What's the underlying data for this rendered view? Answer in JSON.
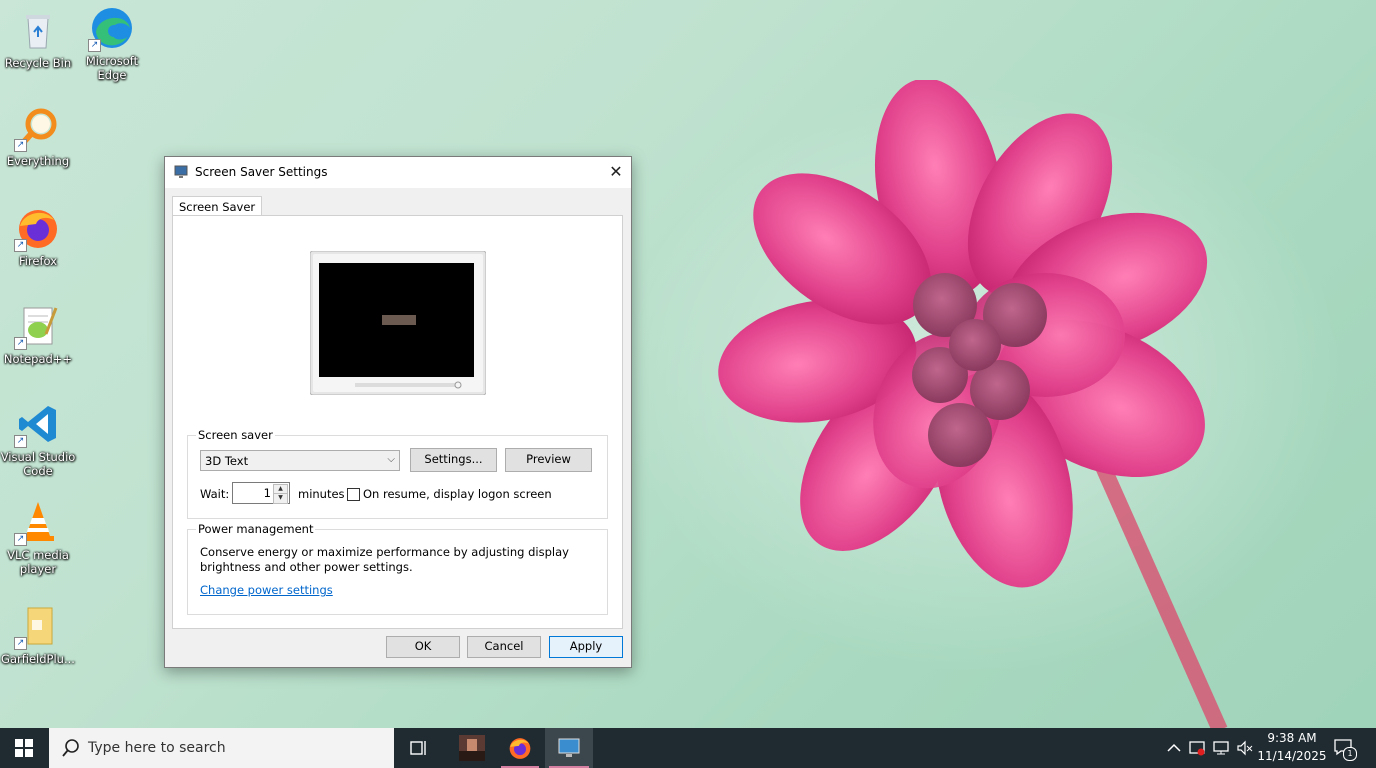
{
  "desktop": {
    "icons": [
      {
        "label": "Recycle Bin",
        "icon": "recycle-bin-icon"
      },
      {
        "label": "Microsoft Edge",
        "icon": "edge-icon"
      },
      {
        "label": "Everything",
        "icon": "everything-search-icon"
      },
      {
        "label": "Firefox",
        "icon": "firefox-icon"
      },
      {
        "label": "Notepad++",
        "icon": "notepad-plus-plus-icon"
      },
      {
        "label": "Visual Studio Code",
        "icon": "vscode-icon"
      },
      {
        "label": "VLC media player",
        "icon": "vlc-icon"
      },
      {
        "label": "GarfieldPlu...",
        "icon": "folder-icon"
      }
    ]
  },
  "dialog": {
    "title": "Screen Saver Settings",
    "close_label": "✕",
    "tab_label": "Screen Saver",
    "screen_saver_group": {
      "label": "Screen saver",
      "selected": "3D Text",
      "settings_button": "Settings...",
      "preview_button": "Preview",
      "wait_label": "Wait:",
      "wait_value": "1",
      "minutes_label": "minutes",
      "resume_checked": false,
      "resume_label": "On resume, display logon screen"
    },
    "power_group": {
      "label": "Power management",
      "description": "Conserve energy or maximize performance by adjusting display brightness and other power settings.",
      "link": "Change power settings"
    },
    "buttons": {
      "ok": "OK",
      "cancel": "Cancel",
      "apply": "Apply"
    }
  },
  "taskbar": {
    "search_placeholder": "Type here to search",
    "time": "9:38 AM",
    "date": "11/14/2025",
    "notification_count": "1"
  },
  "colors": {
    "accent": "#0078d7",
    "taskbar": "#1f2a31",
    "link": "#0066cc"
  }
}
